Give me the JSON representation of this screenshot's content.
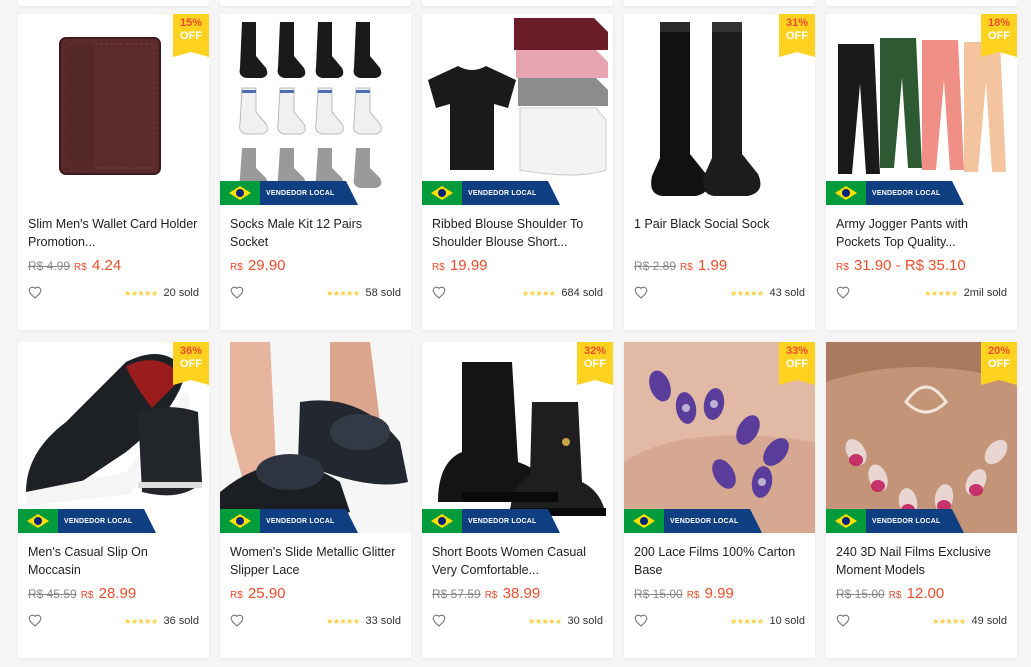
{
  "vendor_label": "VENDEDOR LOCAL",
  "currency": "R$",
  "discount_off_label": "OFF",
  "colors": {
    "accent": "#ee4d2d",
    "badge": "#ffd21f",
    "star": "#ffce3d",
    "vendor_bg": "#0f3f80"
  },
  "products": [
    {
      "title": "Slim Men's Wallet Card Holder Promotion...",
      "old_price": "R$ 4.99",
      "price": "4.24",
      "discount": "15%",
      "vendor": false,
      "rating": 5,
      "sold": "20 sold",
      "image": "wallet-image"
    },
    {
      "title": "Socks Male Kit 12 Pairs Socket",
      "old_price": "",
      "price": "29.90",
      "discount": "",
      "vendor": true,
      "rating": 5,
      "sold": "58 sold",
      "image": "socks-kit-image"
    },
    {
      "title": "Ribbed Blouse Shoulder To Shoulder Blouse Short...",
      "old_price": "",
      "price": "19.99",
      "discount": "",
      "vendor": true,
      "rating": 5,
      "sold": "684 sold",
      "image": "blouse-image"
    },
    {
      "title": "1 Pair Black Social Sock",
      "old_price": "R$ 2.89",
      "price": "1.99",
      "discount": "31%",
      "vendor": false,
      "rating": 5,
      "sold": "43 sold",
      "image": "black-sock-image"
    },
    {
      "title": "Army Jogger Pants with Pockets Top Quality...",
      "old_price": "",
      "price": "31.90 - R$ 35.10",
      "discount": "18%",
      "vendor": true,
      "rating": 5,
      "sold": "2mil sold",
      "image": "jogger-pants-image"
    },
    {
      "title": "Men's Casual Slip On Moccasin",
      "old_price": "R$ 45.59",
      "price": "28.99",
      "discount": "36%",
      "vendor": true,
      "rating": 5,
      "sold": "36 sold",
      "image": "moccasin-image"
    },
    {
      "title": "Women's Slide Metallic Glitter Slipper Lace",
      "old_price": "",
      "price": "25.90",
      "discount": "",
      "vendor": true,
      "rating": 5,
      "sold": "33 sold",
      "image": "slide-slipper-image"
    },
    {
      "title": "Short Boots Women Casual Very Comfortable...",
      "old_price": "R$ 57.59",
      "price": "38.99",
      "discount": "32%",
      "vendor": true,
      "rating": 5,
      "sold": "30 sold",
      "image": "short-boots-image"
    },
    {
      "title": "200 Lace Films 100% Carton Base",
      "old_price": "R$ 15.00",
      "price": "9.99",
      "discount": "33%",
      "vendor": true,
      "rating": 5,
      "sold": "10 sold",
      "image": "nail-films-lace-image"
    },
    {
      "title": "240 3D Nail Films Exclusive Moment Models",
      "old_price": "R$ 15.00",
      "price": "12.00",
      "discount": "20%",
      "vendor": true,
      "rating": 5,
      "sold": "49 sold",
      "image": "nail-films-3d-image"
    }
  ]
}
